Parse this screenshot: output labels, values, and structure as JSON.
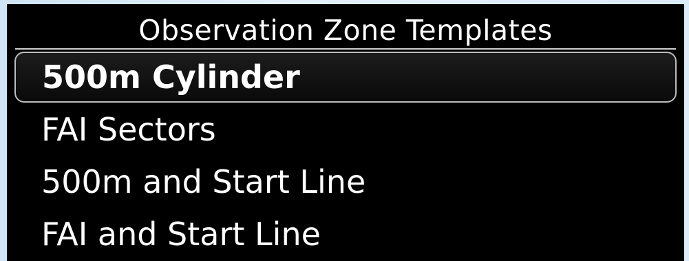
{
  "dialog": {
    "title": "Observation Zone Templates"
  },
  "list": {
    "selected_index": 0,
    "items": [
      {
        "label": "500m Cylinder"
      },
      {
        "label": "FAI Sectors"
      },
      {
        "label": "500m and Start Line"
      },
      {
        "label": "FAI and Start Line"
      }
    ]
  }
}
